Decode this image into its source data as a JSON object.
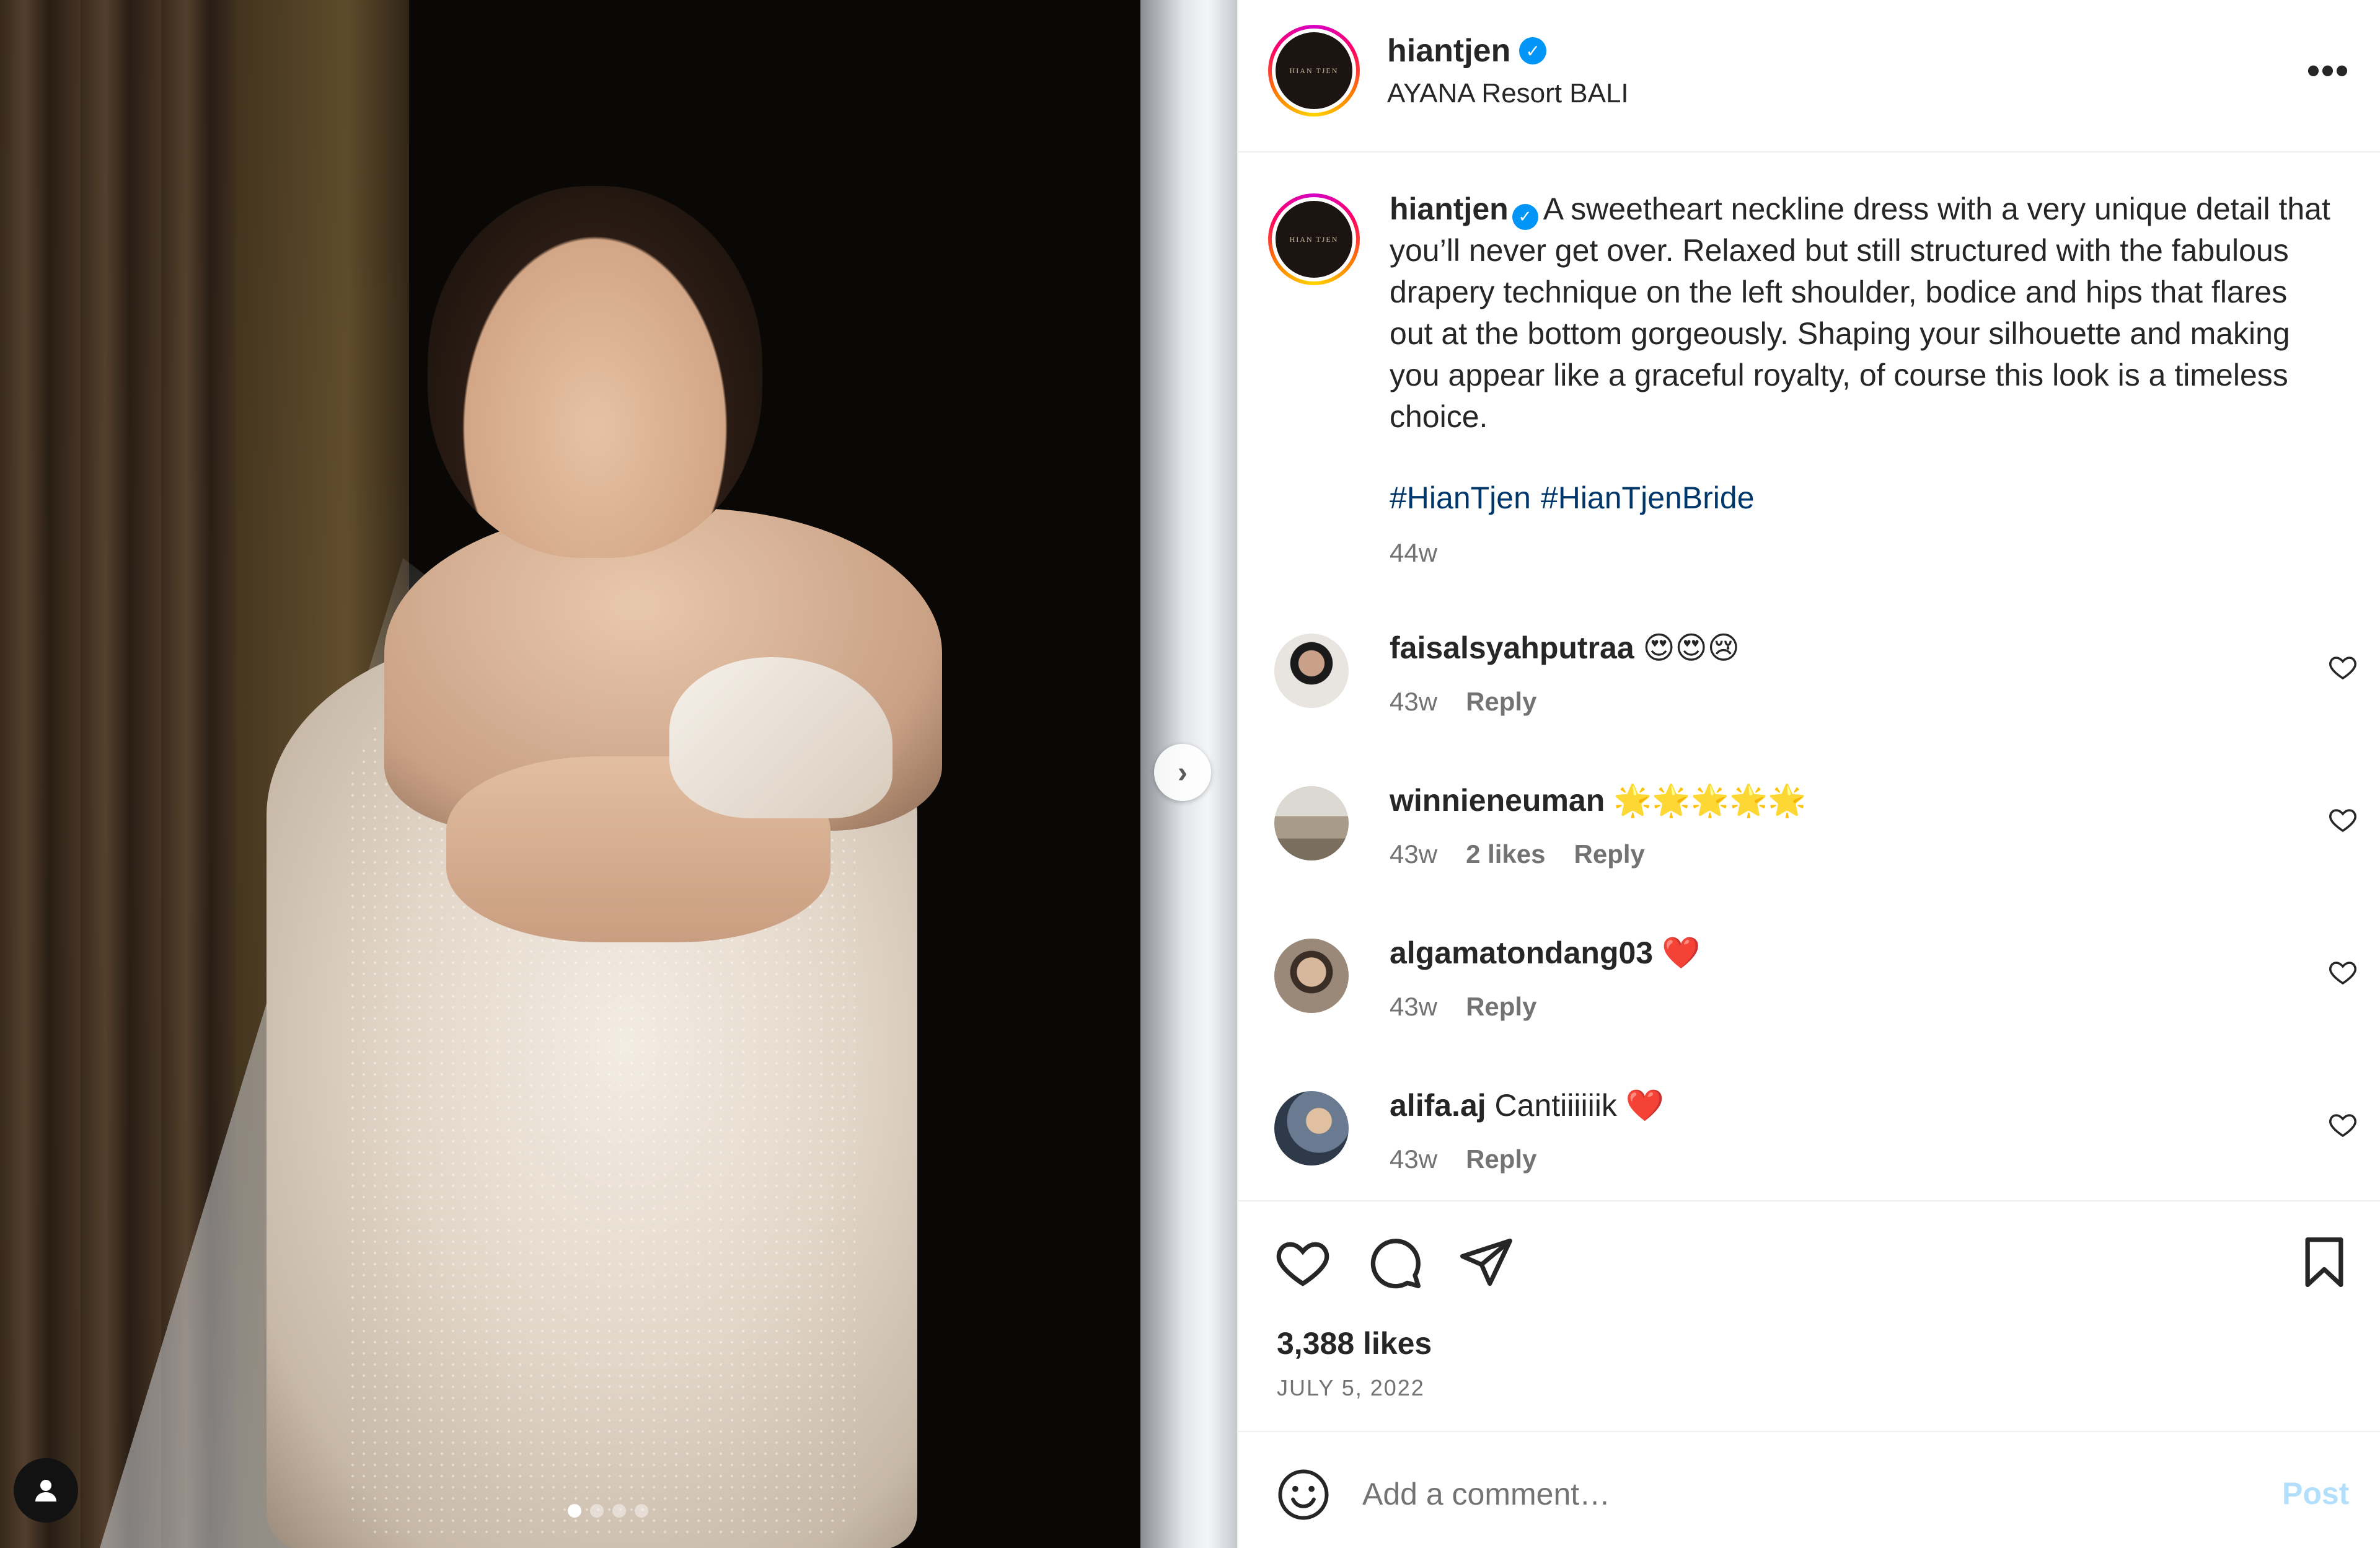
{
  "post": {
    "username": "hiantjen",
    "location": "AYANA Resort BALI",
    "avatar_text": "HIAN TJEN",
    "more_label": "•••",
    "verified_mark": "✓",
    "caption": "A sweetheart neckline dress with a very unique detail that you’ll never get over. Relaxed but still structured with the fabulous drapery technique on the left shoulder, bodice and hips that flares out at the bottom gorgeously. Shaping your silhouette and making you appear like a graceful royalty, of course this look is a timeless choice.",
    "hashtags": [
      "#HianTjen",
      "#HianTjenBride"
    ],
    "time": "44w",
    "likes": "3,388 likes",
    "date": "JULY 5, 2022"
  },
  "carousel": {
    "next_label": "›",
    "dot_count": 4,
    "active_dot": 1
  },
  "comments": [
    {
      "username": "faisalsyahputraa",
      "text": "😍😍😢",
      "time": "43w",
      "likes": "",
      "reply": "Reply",
      "avatar_color": "#e8e4e0"
    },
    {
      "username": "winnieneuman",
      "text": "🌟🌟🌟🌟🌟",
      "time": "43w",
      "likes": "2 likes",
      "reply": "Reply",
      "avatar_color": "#bcae98"
    },
    {
      "username": "algamatondang03",
      "text": "❤️",
      "time": "43w",
      "likes": "",
      "reply": "Reply",
      "avatar_color": "#9a8878"
    },
    {
      "username": "alifa.aj",
      "text": "Cantiiiiiik ❤️",
      "time": "43w",
      "likes": "",
      "reply": "Reply",
      "avatar_color": "#4a5a70"
    }
  ],
  "composer": {
    "placeholder": "Add a comment…",
    "post_label": "Post"
  },
  "colors": {
    "link": "#00376b",
    "secondary_text": "#737373",
    "verified": "#0095f6",
    "post_disabled": "#b2dffc"
  },
  "icons": [
    "heart-icon",
    "comment-icon",
    "share-icon",
    "bookmark-icon",
    "emoji-icon",
    "more-icon",
    "chevron-right-icon",
    "user-tag-icon"
  ]
}
